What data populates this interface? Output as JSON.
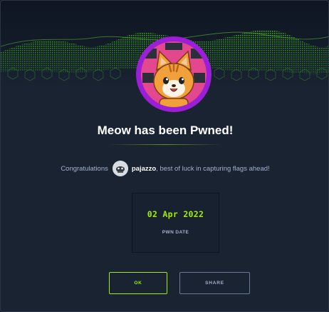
{
  "modal": {
    "title": "Meow has been Pwned!",
    "congrats_prefix": "Congratulations",
    "username": "pajazzo",
    "congrats_suffix": ", best of luck in capturing flags ahead!",
    "pwn_date": "02 Apr 2022",
    "pwn_date_label": "PWN DATE",
    "ok_label": "OK",
    "share_label": "SHARE"
  },
  "colors": {
    "accent": "#9fef00",
    "avatar_ring": "#9b1fd6",
    "background": "#1a2332"
  },
  "icons": {
    "machine_avatar": "cat-icon",
    "user_avatar": "user-avatar-icon"
  }
}
